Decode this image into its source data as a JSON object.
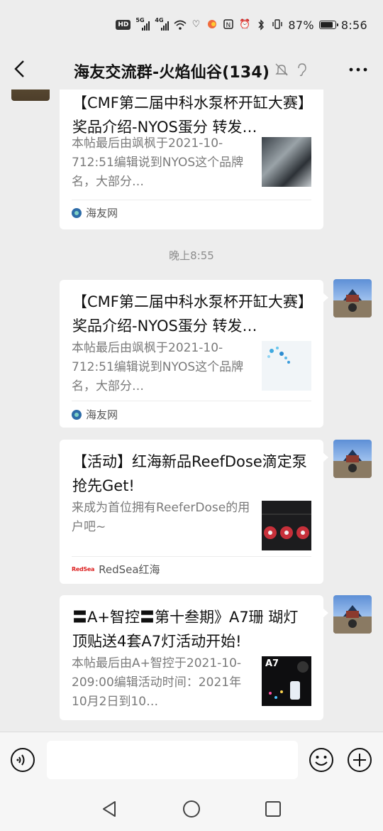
{
  "status_bar": {
    "hd_label": "HD",
    "sim1_label": "5G",
    "sim2_label": "4G",
    "wifi_label": "6",
    "battery_percent": "87%",
    "battery_level": 0.87,
    "time": "8:56",
    "icons": [
      "hd-icon",
      "signal-icon",
      "signal-icon",
      "wifi-icon",
      "heart-icon",
      "app-icon",
      "nfc-icon",
      "alarm-icon",
      "bluetooth-icon",
      "vibrate-icon",
      "battery-icon"
    ]
  },
  "header": {
    "title": "海友交流群-火焰仙谷(134)",
    "icons": [
      "back-icon",
      "mute-icon",
      "ear-icon",
      "more-icon"
    ]
  },
  "messages": [
    {
      "side": "left",
      "title": "【CMF第二届中科水泵杯开缸大赛】奖品介绍-NYOS蛋分 转发…",
      "description": "本帖最后由飒枫于2021-10-712:51编辑说到NYOS这个品牌名，大部分…",
      "source": "海友网",
      "source_icon": "haiyou-logo-icon"
    },
    {
      "timestamp": "晚上8:55"
    },
    {
      "side": "right",
      "title": "【CMF第二届中科水泵杯开缸大赛】奖品介绍-NYOS蛋分 转发…",
      "description": "本帖最后由飒枫于2021-10-712:51编辑说到NYOS这个品牌名，大部分…",
      "source": "海友网",
      "source_icon": "haiyou-logo-icon"
    },
    {
      "side": "right",
      "title": "【活动】红海新品ReefDose滴定泵抢先Get!",
      "description": "来成为首位拥有ReeferDose的用户吧~",
      "source": "RedSea红海",
      "source_icon": "redsea-logo-icon",
      "source_logo_text": "RedSea"
    },
    {
      "side": "right",
      "title": "〓A+智控〓第十叁期》A7珊 瑚灯顶贴送4套A7灯活动开始!",
      "description": "本帖最后由A+智控于2021-10-209:00编辑活动时间：2021年10月2日到10…",
      "thumb_text": "A7",
      "source_icon": "haiyou-logo-icon"
    }
  ],
  "input_bar": {
    "placeholder": "",
    "icons": [
      "voice-icon",
      "emoji-icon",
      "plus-icon"
    ]
  },
  "nav_bar": {
    "icons": [
      "nav-back-icon",
      "nav-home-icon",
      "nav-recent-icon"
    ]
  },
  "colors": {
    "background": "#ededed",
    "card": "#ffffff",
    "muted_text": "#7a7a7a",
    "input_bar": "#f6f6f6"
  }
}
